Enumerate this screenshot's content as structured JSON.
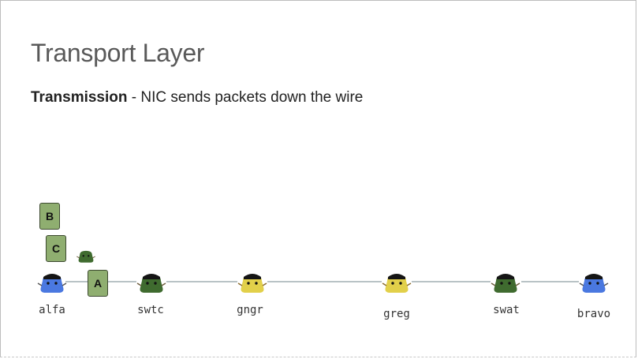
{
  "slide": {
    "title": "Transport Layer",
    "subtitle_bold": "Transmission",
    "subtitle_rest": " - NIC sends packets down the wire"
  },
  "nodes": [
    {
      "name": "alfa",
      "color": "#4a78e0",
      "icon": "monster-icon"
    },
    {
      "name": "swtc",
      "color": "#3f6b2f",
      "icon": "monster-icon"
    },
    {
      "name": "gngr",
      "color": "#e2d04a",
      "icon": "monster-icon"
    },
    {
      "name": "greg",
      "color": "#e2d04a",
      "icon": "monster-icon"
    },
    {
      "name": "swat",
      "color": "#3f6b2f",
      "icon": "monster-icon"
    },
    {
      "name": "bravo",
      "color": "#4a78e0",
      "icon": "monster-icon"
    }
  ],
  "packets": [
    {
      "label": "B"
    },
    {
      "label": "C"
    },
    {
      "label": "A"
    }
  ],
  "colors": {
    "packet_fill": "#8fae70",
    "wire": "#b9c3c6"
  }
}
